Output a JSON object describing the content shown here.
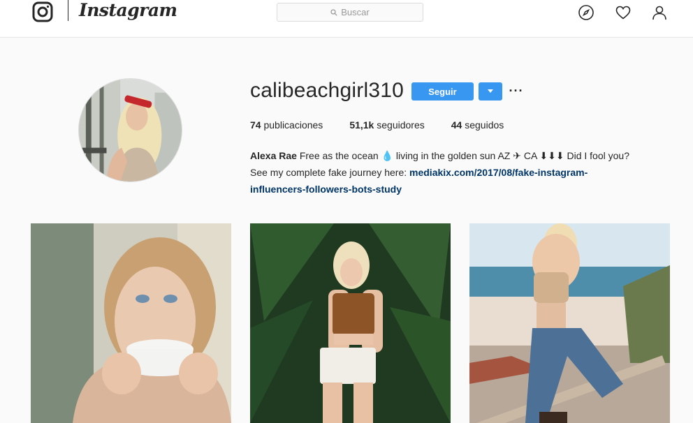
{
  "header": {
    "wordmark": "Instagram",
    "search_placeholder": "Buscar",
    "icons": [
      "instagram-camera-icon",
      "search-icon",
      "compass-icon",
      "heart-icon",
      "user-icon"
    ]
  },
  "profile": {
    "username": "calibeachgirl310",
    "follow_label": "Seguir",
    "more_label": "···",
    "stats": [
      {
        "value": "74",
        "label": "publicaciones"
      },
      {
        "value": "51,1k",
        "label": "seguidores"
      },
      {
        "value": "44",
        "label": "seguidos"
      }
    ],
    "bio": {
      "name": "Alexa Rae",
      "line1_text": "Free as the ocean 💧 living in the golden sun AZ ✈ CA ⬇⬇⬇ Did I fool you?",
      "line2_text": "See my complete fake journey here:",
      "link_part1": "mediakix.com/2017/08/fake-instagram-",
      "link_part2": "influencers-followers-bots-study"
    }
  },
  "colors": {
    "accent": "#3897f0",
    "link": "#003569",
    "background": "#fafafa",
    "text": "#262626"
  }
}
